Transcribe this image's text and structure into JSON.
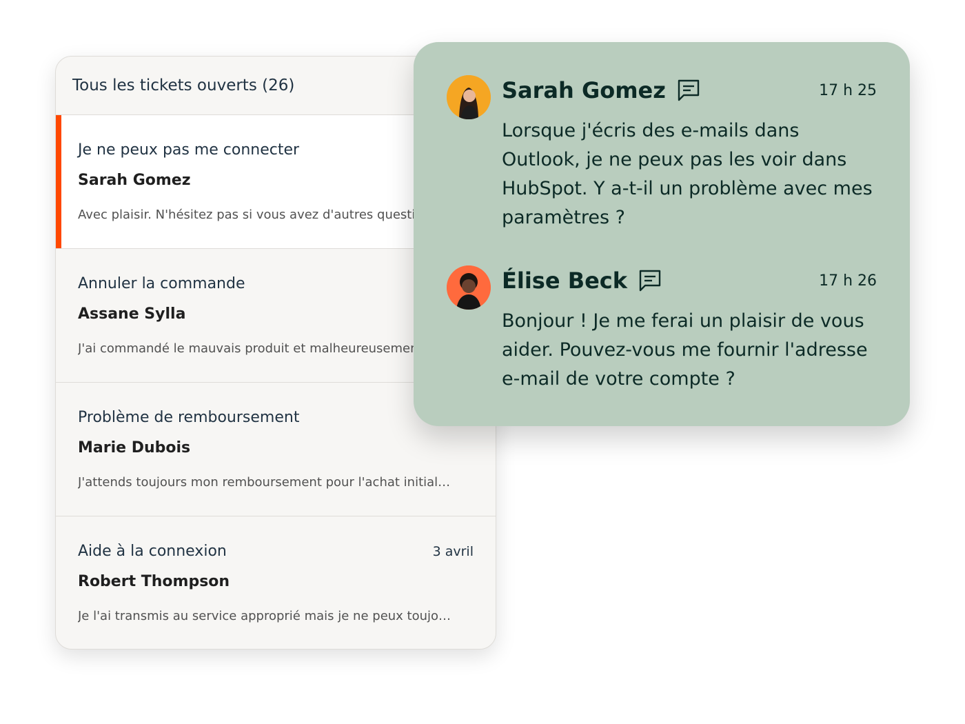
{
  "tickets": {
    "header": "Tous les tickets ouverts (26)",
    "items": [
      {
        "subject": "Je ne peux pas me connecter",
        "name": "Sarah Gomez",
        "preview": "Avec plaisir. N'hésitez pas si vous avez d'autres questions.",
        "date": ""
      },
      {
        "subject": "Annuler la commande",
        "name": "Assane Sylla",
        "preview": "J'ai commandé le mauvais produit et malheureusement",
        "date": ""
      },
      {
        "subject": "Problème de remboursement",
        "name": "Marie Dubois",
        "preview": "J'attends toujours mon remboursement pour l'achat initial…",
        "date": ""
      },
      {
        "subject": "Aide à la connexion",
        "name": "Robert Thompson",
        "preview": "Je l'ai transmis au service approprié mais je ne peux toujo…",
        "date": "3 avril"
      }
    ]
  },
  "conversation": {
    "messages": [
      {
        "author": "Sarah Gomez",
        "time": "17 h 25",
        "text": "Lorsque j'écris des e-mails dans Outlook, je ne peux pas les voir dans HubSpot. Y a-t-il un problème avec mes paramètres ?",
        "avatar_bg": "#f5a623",
        "icon": "chat-bubble-icon"
      },
      {
        "author": "Élise Beck",
        "time": "17 h 26",
        "text": "Bonjour ! Je me ferai un plaisir de vous aider. Pouvez-vous me fournir l'adresse e-mail de votre compte ?",
        "avatar_bg": "#ff6a3d",
        "icon": "chat-bubble-icon"
      }
    ]
  },
  "colors": {
    "accent": "#ff4800",
    "card_bg": "#b9cdbe",
    "text_dark": "#0c2a26"
  }
}
